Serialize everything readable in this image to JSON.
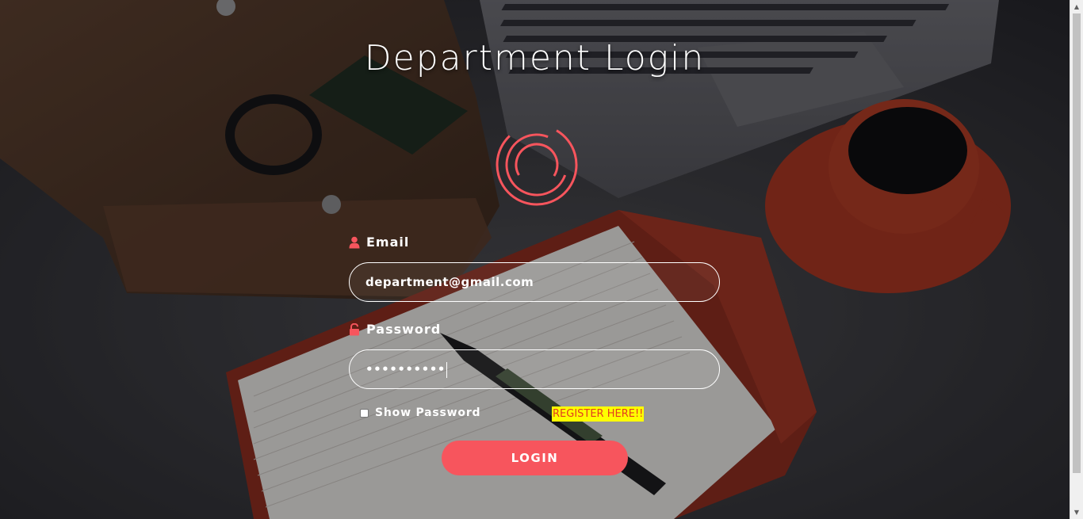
{
  "page": {
    "title": "Department Login"
  },
  "form": {
    "email_label": "Email",
    "email_value": "department@gmail.com",
    "password_label": "Password",
    "password_value": "••••••••••",
    "show_password_label": "Show Password",
    "show_password_checked": false,
    "register_link": "REGISTER HERE!!",
    "login_button": "LOGIN"
  },
  "icons": {
    "email": "user-icon",
    "password": "unlock-icon",
    "spinner": "spinner-icon"
  },
  "colors": {
    "accent": "#f7555d",
    "register_bg": "#ffff00",
    "register_text": "#e23b1f",
    "text": "#ffffff"
  }
}
